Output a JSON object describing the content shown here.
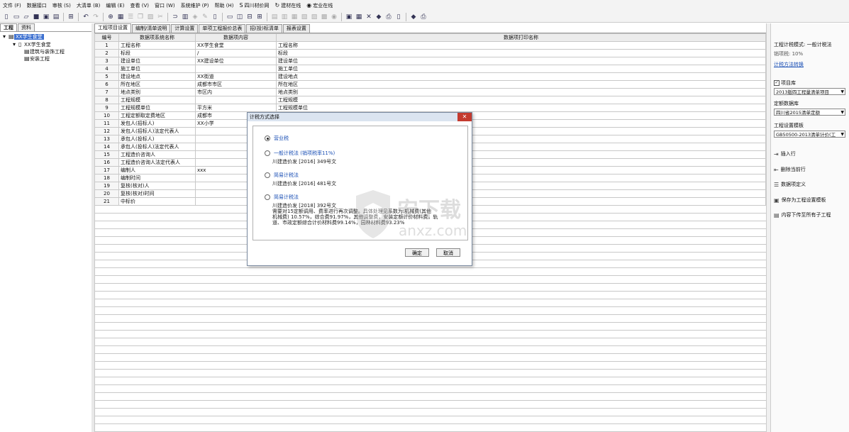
{
  "menubar": [
    {
      "label": "文件 (F)"
    },
    {
      "label": "数据接口"
    },
    {
      "label": "审核 (S)"
    },
    {
      "label": "大清单 (B)"
    },
    {
      "label": "编辑 (E)"
    },
    {
      "label": "查看 (V)"
    },
    {
      "label": "窗口 (W)"
    },
    {
      "label": "系统维护 (P)"
    },
    {
      "label": "帮助 (H)"
    },
    {
      "label": "四川材价网"
    },
    {
      "label": "建材在线"
    },
    {
      "label": "宏业在线"
    }
  ],
  "left": {
    "tabs": [
      "工程",
      "资料"
    ],
    "tree": [
      {
        "label": "XX学生食堂"
      },
      {
        "label": "XX学生食堂"
      },
      {
        "label": "建筑与装饰工程"
      },
      {
        "label": "安装工程"
      }
    ]
  },
  "main": {
    "tabs": [
      "工程项目设置",
      "编制/清单说明",
      "计算设置",
      "单项工程报价总表",
      "招(投)标清单",
      "报表设置"
    ],
    "columns": [
      "编号",
      "数据项系统名称",
      "数据项内容",
      "数据项打印名称"
    ],
    "rows": [
      {
        "no": "1",
        "name": "工程名称",
        "content": "XX学生食堂",
        "print": "工程名称"
      },
      {
        "no": "2",
        "name": "标段",
        "content": "/",
        "print": "标段"
      },
      {
        "no": "3",
        "name": "建设单位",
        "content": "XX建设单位",
        "print": "建设单位"
      },
      {
        "no": "4",
        "name": "施工单位",
        "content": "",
        "print": "施工单位"
      },
      {
        "no": "5",
        "name": "建设地点",
        "content": "XX街道",
        "print": "建设地点"
      },
      {
        "no": "6",
        "name": "所在地区",
        "content": "成都市市区",
        "print": "所在地区"
      },
      {
        "no": "7",
        "name": "地点类别",
        "content": "市区内",
        "print": "地点类别"
      },
      {
        "no": "8",
        "name": "工程规模",
        "content": "",
        "print": "工程规模"
      },
      {
        "no": "9",
        "name": "工程规模单位",
        "content": "平方米",
        "print": "工程规模单位"
      },
      {
        "no": "10",
        "name": "工程定额取定费地区",
        "content": "成都市",
        "print": ""
      },
      {
        "no": "11",
        "name": "发包人(招标人)",
        "content": "XX小学",
        "print": ""
      },
      {
        "no": "12",
        "name": "发包人(招标人)法定代表人",
        "content": "",
        "print": ""
      },
      {
        "no": "13",
        "name": "承包人(投标人)",
        "content": "",
        "print": ""
      },
      {
        "no": "14",
        "name": "承包人(投标人)法定代表人",
        "content": "",
        "print": ""
      },
      {
        "no": "15",
        "name": "工程造价咨询人",
        "content": "",
        "print": ""
      },
      {
        "no": "16",
        "name": "工程造价咨询人法定代表人",
        "content": "",
        "print": ""
      },
      {
        "no": "17",
        "name": "编制人",
        "content": "xxx",
        "print": ""
      },
      {
        "no": "18",
        "name": "编制时间",
        "content": "",
        "print": ""
      },
      {
        "no": "19",
        "name": "复核(核对)人",
        "content": "",
        "print": ""
      },
      {
        "no": "20",
        "name": "复核(核对)时间",
        "content": "",
        "print": ""
      },
      {
        "no": "21",
        "name": "中标价",
        "content": "",
        "print": ""
      }
    ]
  },
  "right": {
    "tax_mode": "工程计税模式: 一般计税法",
    "tax_rate": "销项税: 10%",
    "switch_link": "计税方法转换",
    "project_check": "项目库",
    "project_select": "2013版四工程量清单项目",
    "quota_label": "定额数据库",
    "quota_select": "四川省2015清单定额",
    "template_label": "工程设置模板",
    "template_select": "GB50500-2013清单计价(工",
    "actions": [
      {
        "label": "插入行",
        "icon": "insert-row-icon"
      },
      {
        "label": "删除当前行",
        "icon": "delete-row-icon"
      },
      {
        "label": "数据项定义",
        "icon": "data-define-icon"
      },
      {
        "label": "保存为工程设置模板",
        "icon": "save-template-icon"
      },
      {
        "label": "内容下传至所有子工程",
        "icon": "push-down-icon"
      }
    ]
  },
  "dialog": {
    "title": "计税方式选择",
    "options": [
      {
        "label": "营业税",
        "desc": []
      },
      {
        "label": "一般计税法 (销项税率11%)",
        "desc": [
          "川建造价发 [2016] 349号文"
        ]
      },
      {
        "label": "简易计税法",
        "desc": [
          "川建造价发 [2016] 481号文"
        ]
      },
      {
        "label": "简易计税法",
        "desc": [
          "川建造价发 [2018] 392号文",
          "需要对15定额调用、费率进行再次调整。具体处理见系数为:机械费(其他",
          "机械费) 10.57%，综合费91.97%，其他调整费，安装定额计价材料费，轨",
          "道、市政定额综合计价材料费99.14%，园林材料费93.23%"
        ]
      }
    ],
    "ok": "确定",
    "cancel": "取消"
  },
  "watermark": {
    "text": "安下载",
    "url": "anxz.com"
  }
}
